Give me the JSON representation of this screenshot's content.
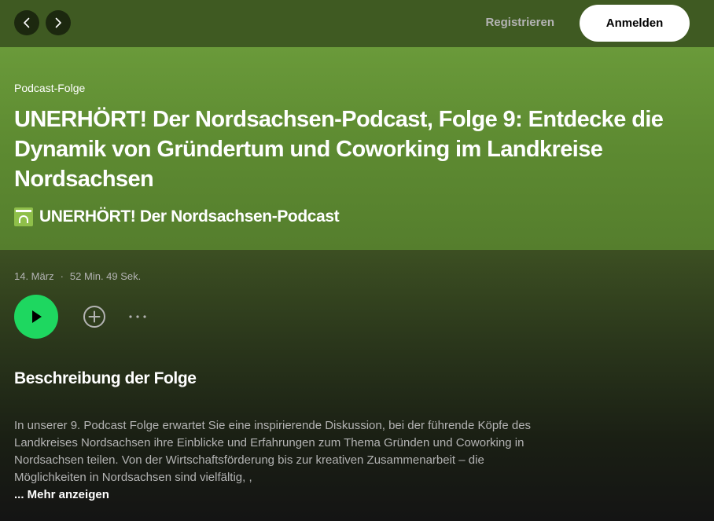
{
  "topbar": {
    "register_label": "Registrieren",
    "login_label": "Anmelden"
  },
  "header": {
    "type_label": "Podcast-Folge",
    "title": "UNERHÖRT! Der Nordsachsen-Podcast, Folge 9: Entdecke die Dynamik von Gründertum und Coworking im Landkreise Nordsachsen",
    "show_name": "UNERHÖRT! Der Nordsachsen-Podcast"
  },
  "meta": {
    "date": "14. März",
    "separator": "·",
    "duration": "52 Min. 49 Sek."
  },
  "actions": {
    "play_icon": "play-icon",
    "add_icon": "add-circle-icon",
    "more_icon": "more-horizontal-icon"
  },
  "description": {
    "heading": "Beschreibung der Folge",
    "text": "In unserer 9. Podcast Folge erwartet Sie eine inspirierende Diskussion, bei der führende Köpfe des Landkreises Nordsachsen ihre Einblicke und Erfahrungen zum Thema Gründen und Coworking in Nordsachsen teilen. Von der Wirtschaftsförderung bis zur kreativen Zusammenarbeit – die Möglichkeiten in Nordsachsen sind vielfältig, ,",
    "show_more_label": "... Mehr anzeigen"
  },
  "colors": {
    "accent_green": "#1ed760",
    "header_green": "#5d8a31",
    "topbar_green": "#3f5a22"
  }
}
